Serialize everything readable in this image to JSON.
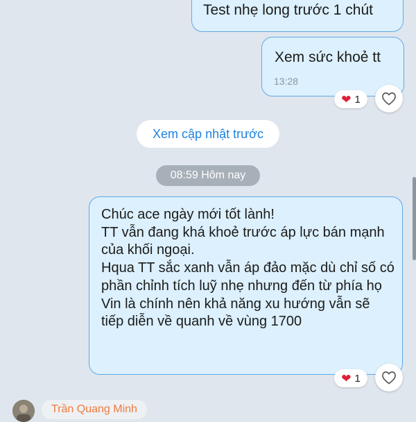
{
  "messages": [
    {
      "text": "Test nhẹ long trước 1 chút"
    },
    {
      "text": "Xem sức khoẻ tt",
      "time": "13:28",
      "reaction": {
        "icon": "heart-icon",
        "count": "1"
      }
    },
    {
      "text": "Chúc ace ngày mới tốt lành!\nTT vẫn đang khá khoẻ trước áp lực bán mạnh của khối ngoại.\nHqua TT sắc xanh vẫn áp đảo mặc dù chỉ số có phần chỉnh tích luỹ nhẹ nhưng đến từ phía họ Vin là chính nên khả năng xu hướng vẫn sẽ tiếp diễn về quanh về vùng 1700",
      "reaction": {
        "icon": "heart-icon",
        "count": "1"
      }
    }
  ],
  "view_previous_label": "Xem cập nhật trước",
  "date_separator": "08:59 Hôm nay",
  "next_sender": {
    "name": "Trần Quang Minh"
  },
  "colors": {
    "bubble": "#dcf0fd",
    "bubble_border": "#5fa9e6",
    "link": "#1d82de",
    "sender_name": "#ee7a3b",
    "heart": "#e0203a"
  }
}
